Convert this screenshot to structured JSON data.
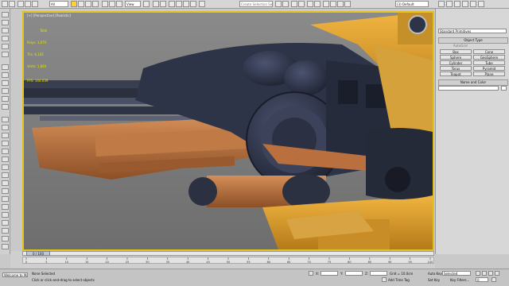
{
  "toolbar": {
    "filter_value": "All",
    "view_value": "View",
    "named_selection_placeholder": "Create Selection Set",
    "workspace_value": "(3) Default"
  },
  "viewport": {
    "label": "[+] [Perspective] [Realistic]",
    "stats_header": "Total",
    "stats": [
      {
        "label": "Polys:",
        "value": "3,070"
      },
      {
        "label": "Tris:",
        "value": "6,102"
      },
      {
        "label": "Verts:",
        "value": "1,840"
      }
    ],
    "fps_label": "FPS:",
    "fps_value": "144.039"
  },
  "command_panel": {
    "category_value": "Standard Primitives",
    "object_type_title": "Object Type",
    "autogrid_label": "AutoGrid",
    "object_buttons": [
      "Box",
      "Cone",
      "Sphere",
      "GeoSphere",
      "Cylinder",
      "Tube",
      "Torus",
      "Pyramid",
      "Teapot",
      "Plane"
    ],
    "name_color_title": "Name and Color"
  },
  "timeline": {
    "frame_display": "0 / 100",
    "ticks": [
      "0",
      "5",
      "10",
      "15",
      "20",
      "25",
      "30",
      "35",
      "40",
      "45",
      "50",
      "55",
      "60",
      "65",
      "70",
      "75",
      "80",
      "85",
      "90",
      "95",
      "100"
    ]
  },
  "status": {
    "maxscript_text": "Welcome to MA",
    "selection_text": "None Selected",
    "prompt_text": "Click or click-and-drag to select objects",
    "x_value": "",
    "y_value": "",
    "z_value": "",
    "grid_text": "Grid = 10.0cm",
    "add_time_tag": "Add Time Tag",
    "auto_key": "Auto Key",
    "set_key": "Set Key",
    "key_mode_value": "Selected",
    "key_filters": "Key Filters...",
    "frame_value": "0"
  },
  "colors": {
    "viewport_border": "#e2c21d",
    "stats_text": "#e4e400",
    "hull_dark": "#2e3448",
    "hull_orange": "#d99a2b",
    "hull_copper": "#b5703e"
  }
}
